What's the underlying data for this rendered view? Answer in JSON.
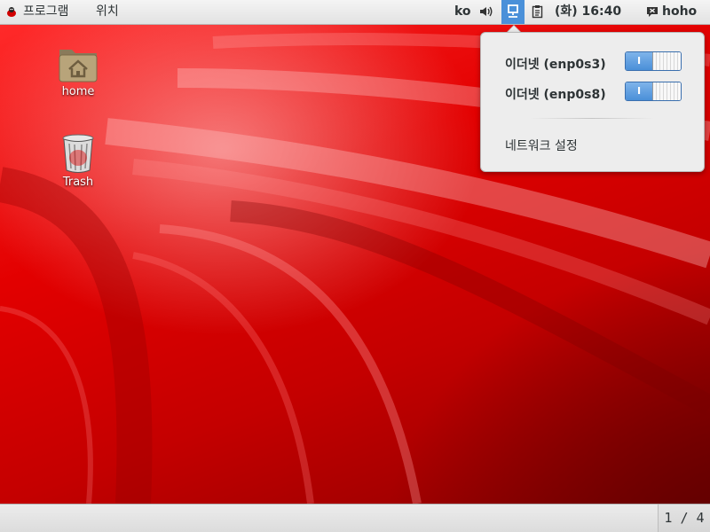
{
  "top_panel": {
    "applications_label": "프로그램",
    "places_label": "위치",
    "language": "ko",
    "clock": "(화) 16:40",
    "user_name": "hoho"
  },
  "network_menu": {
    "connections": [
      {
        "label": "이더넷 (enp0s3)",
        "switch_text": "I",
        "enabled": true
      },
      {
        "label": "이더넷 (enp0s8)",
        "switch_text": "I",
        "enabled": true
      }
    ],
    "settings_label": "네트워크 설정"
  },
  "desktop": {
    "icons": [
      {
        "label": "home"
      },
      {
        "label": "Trash"
      }
    ]
  },
  "bottom_panel": {
    "workspace_indicator": "1 / 4"
  },
  "colors": {
    "panel_bg": "#e6e6e6",
    "accent": "#4a90d9",
    "wallpaper": "#d40000"
  }
}
